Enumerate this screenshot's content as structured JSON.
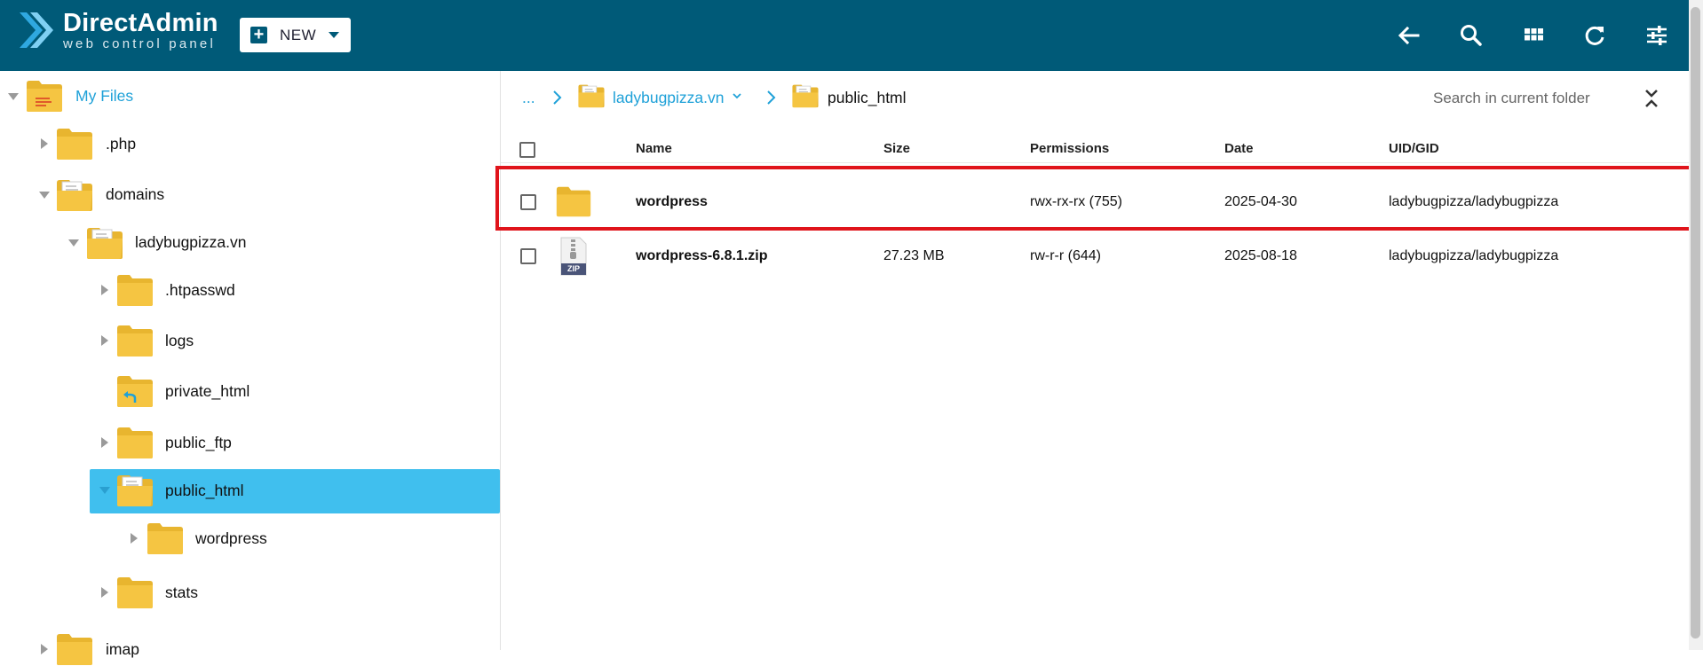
{
  "app": {
    "brand_name": "DirectAdmin",
    "brand_sub": "web control panel",
    "new_button_label": "NEW"
  },
  "toolbar": {
    "icons": [
      "back-arrow-icon",
      "search-icon",
      "grid-view-icon",
      "refresh-icon",
      "settings-sliders-icon"
    ]
  },
  "sidebar": {
    "root_label": "My Files",
    "items": [
      {
        "label": ".php"
      },
      {
        "label": "domains"
      },
      {
        "label": "ladybugpizza.vn"
      },
      {
        "label": ".htpasswd"
      },
      {
        "label": "logs"
      },
      {
        "label": "private_html"
      },
      {
        "label": "public_ftp"
      },
      {
        "label": "public_html"
      },
      {
        "label": "wordpress"
      },
      {
        "label": "stats"
      },
      {
        "label": "imap"
      }
    ]
  },
  "breadcrumb": {
    "ellipsis": "...",
    "domain": "ladybugpizza.vn",
    "current": "public_html"
  },
  "search": {
    "placeholder": "Search in current folder"
  },
  "table": {
    "columns": [
      "Name",
      "Size",
      "Permissions",
      "Date",
      "UID/GID"
    ],
    "rows": [
      {
        "name": "wordpress",
        "size": "",
        "permissions": "rwx-rx-rx (755)",
        "date": "2025-04-30",
        "uid_gid": "ladybugpizza/ladybugpizza",
        "type": "folder"
      },
      {
        "name": "wordpress-6.8.1.zip",
        "size": "27.23 MB",
        "permissions": "rw-r-r (644)",
        "date": "2025-08-18",
        "uid_gid": "ladybugpizza/ladybugpizza",
        "type": "zip",
        "badge": "ZIP"
      }
    ]
  },
  "colors": {
    "topbar": "#005a78",
    "accent": "#1fa1d8",
    "selected": "#40bfee",
    "folder": "#f5c542",
    "highlight": "#e0141b"
  }
}
